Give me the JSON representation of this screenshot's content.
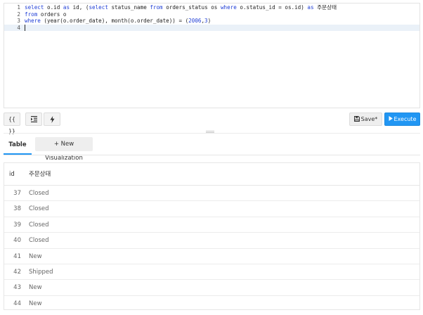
{
  "editor": {
    "lines": [
      {
        "num": "1",
        "tokens": [
          {
            "t": "select",
            "k": true
          },
          {
            "t": " o.id "
          },
          {
            "t": "as",
            "k": true
          },
          {
            "t": " id, ("
          },
          {
            "t": "select",
            "k": true
          },
          {
            "t": " status_name "
          },
          {
            "t": "from",
            "k": true
          },
          {
            "t": " orders_status os "
          },
          {
            "t": "where",
            "k": true
          },
          {
            "t": " o.status_id = os.id) "
          },
          {
            "t": "as",
            "k": true
          },
          {
            "t": " 주문상태"
          }
        ]
      },
      {
        "num": "2",
        "tokens": [
          {
            "t": "from",
            "k": true
          },
          {
            "t": " orders o"
          }
        ]
      },
      {
        "num": "3",
        "tokens": [
          {
            "t": "where",
            "k": true
          },
          {
            "t": " (year(o.order_date), month(o.order_date)) = ("
          },
          {
            "t": "2006",
            "n": true
          },
          {
            "t": ","
          },
          {
            "t": "3",
            "n": true
          },
          {
            "t": ")"
          }
        ]
      },
      {
        "num": "4",
        "tokens": [],
        "active": true
      }
    ]
  },
  "toolbar": {
    "format_label": "{{ }}",
    "indent_icon": "indent-icon",
    "bolt_icon": "lightning-icon",
    "save_icon": "floppy-disk-icon",
    "save_label": "Save*",
    "execute_icon": "play-icon",
    "execute_label": "Execute",
    "accent_color": "#2196f3"
  },
  "tabs": {
    "table_label": "Table",
    "new_viz_label": "+ New Visualization"
  },
  "results": {
    "columns": [
      "id",
      "주문상태"
    ],
    "rows": [
      {
        "id": "37",
        "status": "Closed"
      },
      {
        "id": "38",
        "status": "Closed"
      },
      {
        "id": "39",
        "status": "Closed"
      },
      {
        "id": "40",
        "status": "Closed"
      },
      {
        "id": "41",
        "status": "New"
      },
      {
        "id": "42",
        "status": "Shipped"
      },
      {
        "id": "43",
        "status": "New"
      },
      {
        "id": "44",
        "status": "New"
      }
    ]
  }
}
